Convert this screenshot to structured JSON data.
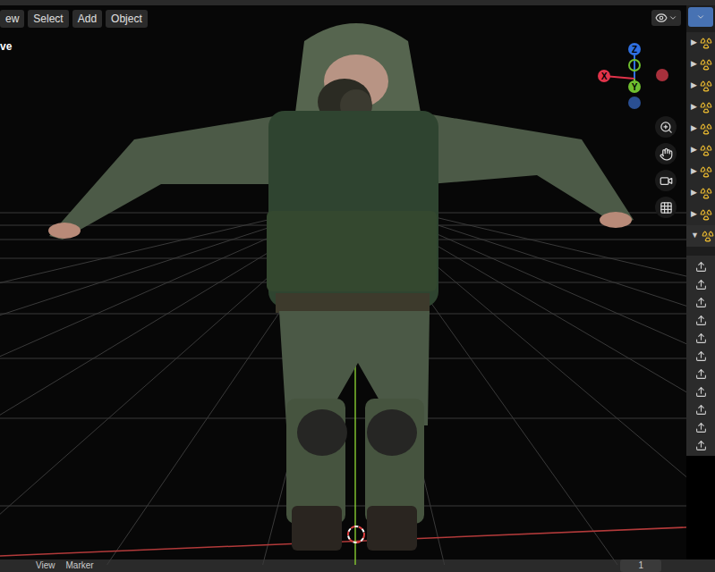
{
  "header": {
    "menus": [
      "ew",
      "Select",
      "Add",
      "Object"
    ]
  },
  "viewport": {
    "label": "ve"
  },
  "gizmo": {
    "axes": [
      {
        "label": "Z",
        "color": "#2f6fe0"
      },
      {
        "label": "X",
        "color": "#e0334a"
      },
      {
        "label": "Y",
        "color": "#6fbf2f"
      }
    ]
  },
  "outliner": {
    "rows": [
      {
        "arrow": "▶",
        "expanded": false
      },
      {
        "arrow": "▶",
        "expanded": false
      },
      {
        "arrow": "▶",
        "expanded": false
      },
      {
        "arrow": "▶",
        "expanded": false
      },
      {
        "arrow": "▶",
        "expanded": false
      },
      {
        "arrow": "▶",
        "expanded": false
      },
      {
        "arrow": "▶",
        "expanded": false
      },
      {
        "arrow": "▶",
        "expanded": false
      },
      {
        "arrow": "▶",
        "expanded": false
      },
      {
        "arrow": "▼",
        "expanded": true
      }
    ]
  },
  "timeline": {
    "menus": [
      "View",
      "Marker"
    ],
    "frame": "1"
  }
}
